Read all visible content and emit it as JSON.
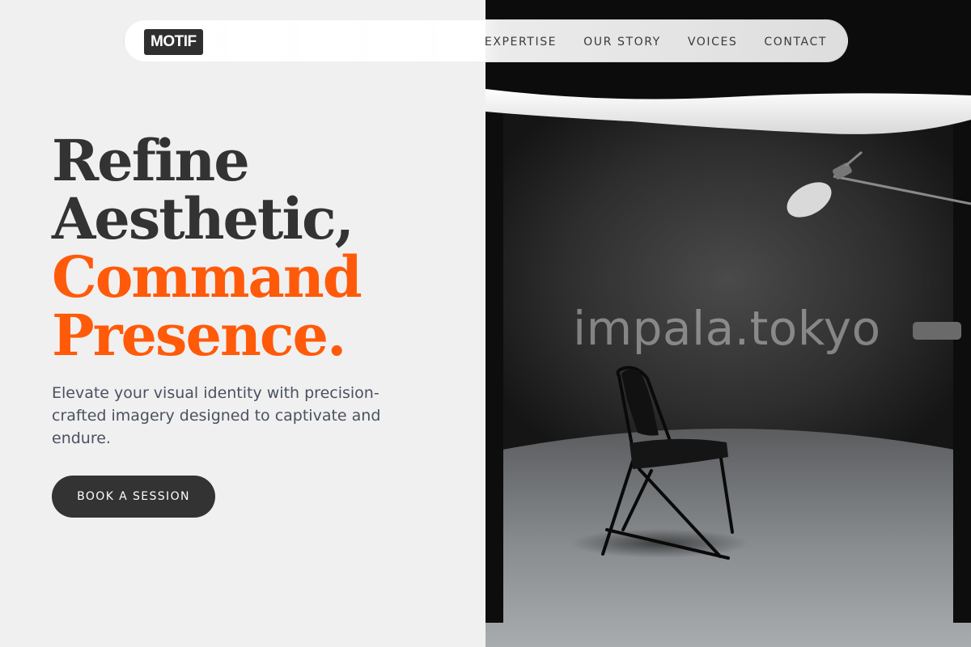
{
  "brand": {
    "logo": "MOTIF"
  },
  "nav": {
    "items": [
      "EXPERTISE",
      "OUR STORY",
      "VOICES",
      "CONTACT"
    ]
  },
  "hero": {
    "headline": {
      "line1": "Refine",
      "line2": "Aesthetic,",
      "line3": "Command",
      "line4": "Presence."
    },
    "subtext": "Elevate your visual identity with precision-crafted imagery designed to captivate and endure.",
    "cta_label": "BOOK A SESSION"
  },
  "image": {
    "watermark": "impala.tokyo"
  },
  "colors": {
    "accent": "#ff5a0a",
    "dark": "#333333",
    "background": "#f0f0f0",
    "body_text": "#4a5160"
  }
}
